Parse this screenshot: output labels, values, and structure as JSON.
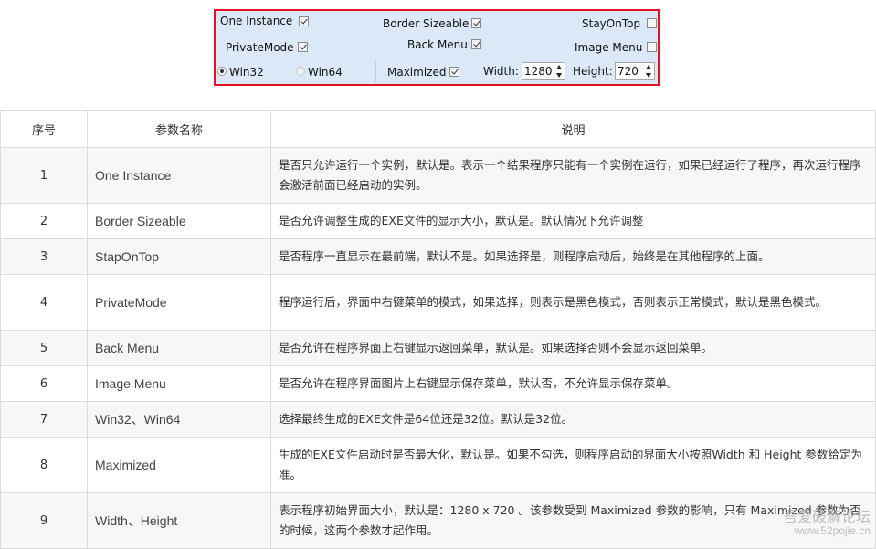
{
  "options_panel": {
    "one_instance": {
      "label": "One Instance",
      "checked": true
    },
    "border_sizeable": {
      "label": "Border Sizeable",
      "checked": true
    },
    "stay_on_top": {
      "label": "StayOnTop",
      "checked": false
    },
    "private_mode": {
      "label": "PrivateMode",
      "checked": true
    },
    "back_menu": {
      "label": "Back Menu",
      "checked": true
    },
    "image_menu": {
      "label": "Image Menu",
      "checked": false
    },
    "win32": {
      "label": "Win32",
      "selected": true
    },
    "win64": {
      "label": "Win64",
      "selected": false
    },
    "maximized": {
      "label": "Maximized",
      "checked": true
    },
    "width": {
      "label": "Width:",
      "value": "1280"
    },
    "height": {
      "label": "Height:",
      "value": "720"
    }
  },
  "table": {
    "headers": [
      "序号",
      "参数名称",
      "说明"
    ],
    "rows": [
      {
        "num": "1",
        "name": "One Instance",
        "desc": "是否只允许运行一个实例，默认是。表示一个结果程序只能有一个实例在运行，如果已经运行了程序，再次运行程序会激活前面已经启动的实例。"
      },
      {
        "num": "2",
        "name": "Border Sizeable",
        "desc": "是否允许调整生成的EXE文件的显示大小，默认是。默认情况下允许调整"
      },
      {
        "num": "3",
        "name": "StapOnTop",
        "desc": "是否程序一直显示在最前端，默认不是。如果选择是，则程序启动后，始终是在其他程序的上面。"
      },
      {
        "num": "4",
        "name": "PrivateMode",
        "desc": "程序运行后，界面中右键菜单的模式，如果选择，则表示是黑色模式，否则表示正常模式，默认是黑色模式。"
      },
      {
        "num": "5",
        "name": "Back Menu",
        "desc": "是否允许在程序界面上右键显示返回菜单，默认是。如果选择否则不会显示返回菜单。"
      },
      {
        "num": "6",
        "name": "Image Menu",
        "desc": "是否允许在程序界面图片上右键显示保存菜单，默认否，不允许显示保存菜单。"
      },
      {
        "num": "7",
        "name": "Win32、Win64",
        "desc": "选择最终生成的EXE文件是64位还是32位。默认是32位。"
      },
      {
        "num": "8",
        "name": "Maximized",
        "desc": "生成的EXE文件启动时是否最大化，默认是。如果不勾选，则程序启动的界面大小按照Width 和 Height 参数给定为准。"
      },
      {
        "num": "9",
        "name": "Width、Height",
        "desc": "表示程序初始界面大小，默认是：1280 x 720 。该参数受到 Maximized 参数的影响，只有 Maximized 参数为否的时候，这两个参数才起作用。"
      }
    ]
  },
  "watermark": {
    "line1": "吾爱破解论坛",
    "line2": "www.52pojie.cn"
  }
}
